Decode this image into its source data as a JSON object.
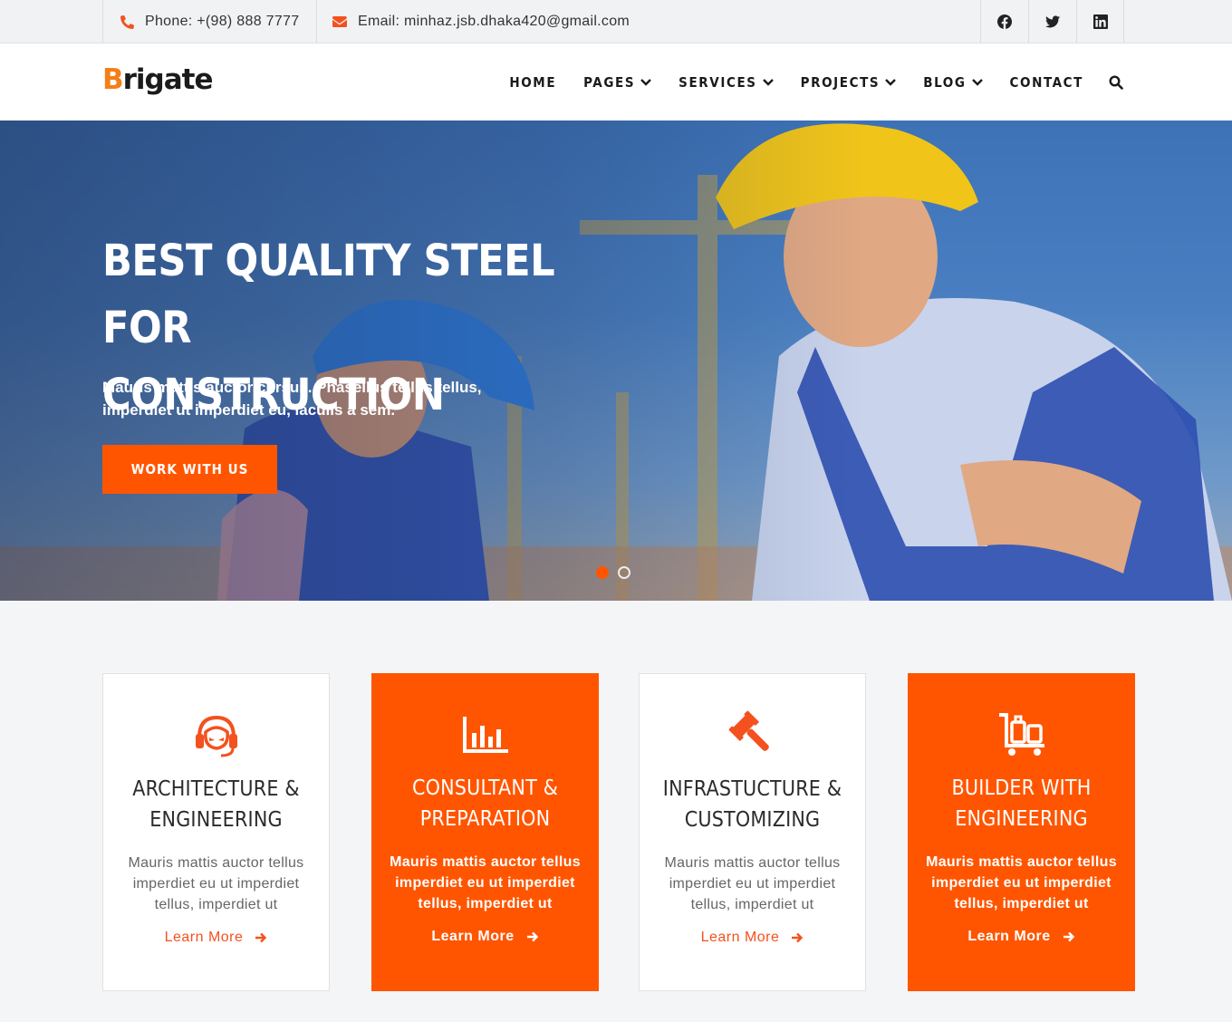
{
  "topbar": {
    "phone": "Phone: +(98) 888 7777",
    "email": "Email: minhaz.jsb.dhaka420@gmail.com",
    "socials": [
      "facebook-icon",
      "twitter-icon",
      "linkedin-icon"
    ]
  },
  "brand": {
    "first_letter": "B",
    "rest": "rigate",
    "accent": "#f57f17"
  },
  "nav": {
    "items": [
      {
        "label": "HOME",
        "dropdown": false
      },
      {
        "label": "PAGES",
        "dropdown": true
      },
      {
        "label": "SERVICES",
        "dropdown": true
      },
      {
        "label": "PROJECTS",
        "dropdown": true
      },
      {
        "label": "BLOG",
        "dropdown": true
      },
      {
        "label": "CONTACT",
        "dropdown": false
      }
    ],
    "search_icon": "search-icon"
  },
  "hero": {
    "title_line1": "BEST QUALITY STEEL FOR",
    "title_line2": "CONSTRUCTION",
    "subtitle": "Mauris mattis auctor cursus. Phasellus tellus tellus, imperdiet ut imperdiet eu, iaculis a sem.",
    "cta_label": "WORK WITH US",
    "slides_total": 2,
    "active_slide": 1
  },
  "services": [
    {
      "icon": "headset-icon",
      "title_line1": "ARCHITECTURE &",
      "title_line2": "ENGINEERING",
      "text": "Mauris mattis auctor tellus imperdiet eu ut imperdiet tellus, imperdiet ut",
      "link": "Learn More",
      "style": "light"
    },
    {
      "icon": "bar-chart-icon",
      "title_line1": "CONSULTANT &",
      "title_line2": "PREPARATION",
      "text": "Mauris mattis auctor tellus imperdiet eu ut imperdiet tellus, imperdiet ut",
      "link": "Learn More",
      "style": "orange"
    },
    {
      "icon": "gavel-icon",
      "title_line1": "INFRASTUCTURE &",
      "title_line2": "CUSTOMIZING",
      "text": "Mauris mattis auctor tellus imperdiet eu ut imperdiet tellus, imperdiet ut",
      "link": "Learn More",
      "style": "light"
    },
    {
      "icon": "luggage-cart-icon",
      "title_line1": "BUILDER WITH",
      "title_line2": "ENGINEERING",
      "text": "Mauris mattis auctor tellus imperdiet eu ut imperdiet tellus, imperdiet ut",
      "link": "Learn More",
      "style": "orange"
    }
  ],
  "colors": {
    "accent": "#ff5500",
    "topbar_bg": "#f1f2f4",
    "page_bg": "#f4f5f7"
  }
}
